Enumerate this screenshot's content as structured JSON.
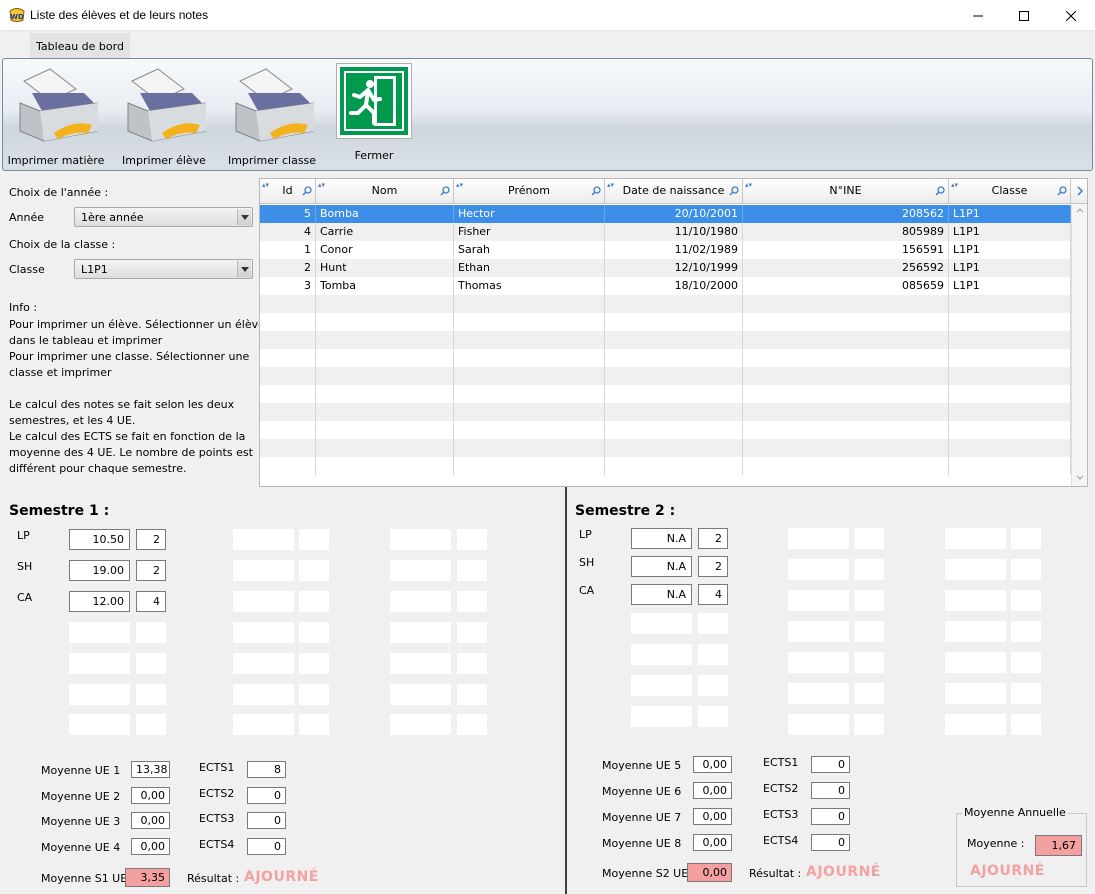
{
  "window": {
    "title": "Liste des élèves et de leurs notes"
  },
  "tab": {
    "label": "Tableau de bord"
  },
  "ribbon": {
    "print_subject": "Imprimer matière",
    "print_student": "Imprimer élève",
    "print_class": "Imprimer classe",
    "close": "Fermer"
  },
  "filters": {
    "year_heading": "Choix de l'année :",
    "year_label": "Année",
    "year_value": "1ère année",
    "class_heading": "Choix de la classe :",
    "class_label": "Classe",
    "class_value": "L1P1"
  },
  "info": {
    "heading": "Info :",
    "lines": [
      "Pour imprimer un élève. Sélectionner un élève",
      "dans le tableau et imprimer",
      "Pour imprimer une classe. Sélectionner une",
      "classe et imprimer",
      "",
      "Le calcul des notes se fait selon les deux",
      "semestres, et les 4 UE.",
      "Le calcul des ECTS se fait en fonction de la",
      "moyenne des 4 UE. Le nombre de points est",
      "différent pour chaque semestre."
    ]
  },
  "table": {
    "columns": [
      "Id",
      "Nom",
      "Prénom",
      "Date de naissance",
      "N°INE",
      "Classe"
    ],
    "rows": [
      [
        "5",
        "Bomba",
        "Hector",
        "20/10/2001",
        "208562",
        "L1P1"
      ],
      [
        "4",
        "Carrie",
        "Fisher",
        "11/10/1980",
        "805989",
        "L1P1"
      ],
      [
        "1",
        "Conor",
        "Sarah",
        "11/02/1989",
        "156591",
        "L1P1"
      ],
      [
        "2",
        "Hunt",
        "Ethan",
        "12/10/1999",
        "256592",
        "L1P1"
      ],
      [
        "3",
        "Tomba",
        "Thomas",
        "18/10/2000",
        "085659",
        "L1P1"
      ]
    ],
    "selected_row": 0
  },
  "semester1": {
    "title": "Semestre 1 :",
    "subjects": [
      {
        "name": "LP",
        "grade": "10.50",
        "coef": "2"
      },
      {
        "name": "SH",
        "grade": "19.00",
        "coef": "2"
      },
      {
        "name": "CA",
        "grade": "12.00",
        "coef": "4"
      }
    ],
    "ue": [
      {
        "label": "Moyenne UE 1",
        "value": "13,38",
        "ects_label": "ECTS1",
        "ects": "8"
      },
      {
        "label": "Moyenne UE 2",
        "value": "0,00",
        "ects_label": "ECTS2",
        "ects": "0"
      },
      {
        "label": "Moyenne UE 3",
        "value": "0,00",
        "ects_label": "ECTS3",
        "ects": "0"
      },
      {
        "label": "Moyenne UE 4",
        "value": "0,00",
        "ects_label": "ECTS4",
        "ects": "0"
      }
    ],
    "avg_label": "Moyenne S1 UE",
    "avg_value": "3,35",
    "result_label": "Résultat :",
    "result_value": "AJOURNÉ"
  },
  "semester2": {
    "title": "Semestre 2 :",
    "subjects": [
      {
        "name": "LP",
        "grade": "N.A",
        "coef": "2"
      },
      {
        "name": "SH",
        "grade": "N.A",
        "coef": "2"
      },
      {
        "name": "CA",
        "grade": "N.A",
        "coef": "4"
      }
    ],
    "ue": [
      {
        "label": "Moyenne UE 5",
        "value": "0,00",
        "ects_label": "ECTS1",
        "ects": "0"
      },
      {
        "label": "Moyenne UE 6",
        "value": "0,00",
        "ects_label": "ECTS2",
        "ects": "0"
      },
      {
        "label": "Moyenne UE 7",
        "value": "0,00",
        "ects_label": "ECTS3",
        "ects": "0"
      },
      {
        "label": "Moyenne UE 8",
        "value": "0,00",
        "ects_label": "ECTS4",
        "ects": "0"
      }
    ],
    "avg_label": "Moyenne S2 UE",
    "avg_value": "0,00",
    "result_label": "Résultat :",
    "result_value": "AJOURNÉ"
  },
  "annual": {
    "title": "Moyenne Annuelle",
    "avg_label": "Moyenne :",
    "avg_value": "1,67",
    "result_value": "AJOURNÉ"
  },
  "colors": {
    "selected_row": "#3d8ee6",
    "failed_field": "#f4a0a0",
    "failed_text": "#f2a2a2",
    "exit_sign": "#009a4e"
  },
  "icons": [
    "printer-icon",
    "exit-sign-icon",
    "dropdown-arrow-icon",
    "search-icon",
    "sort-icon"
  ]
}
